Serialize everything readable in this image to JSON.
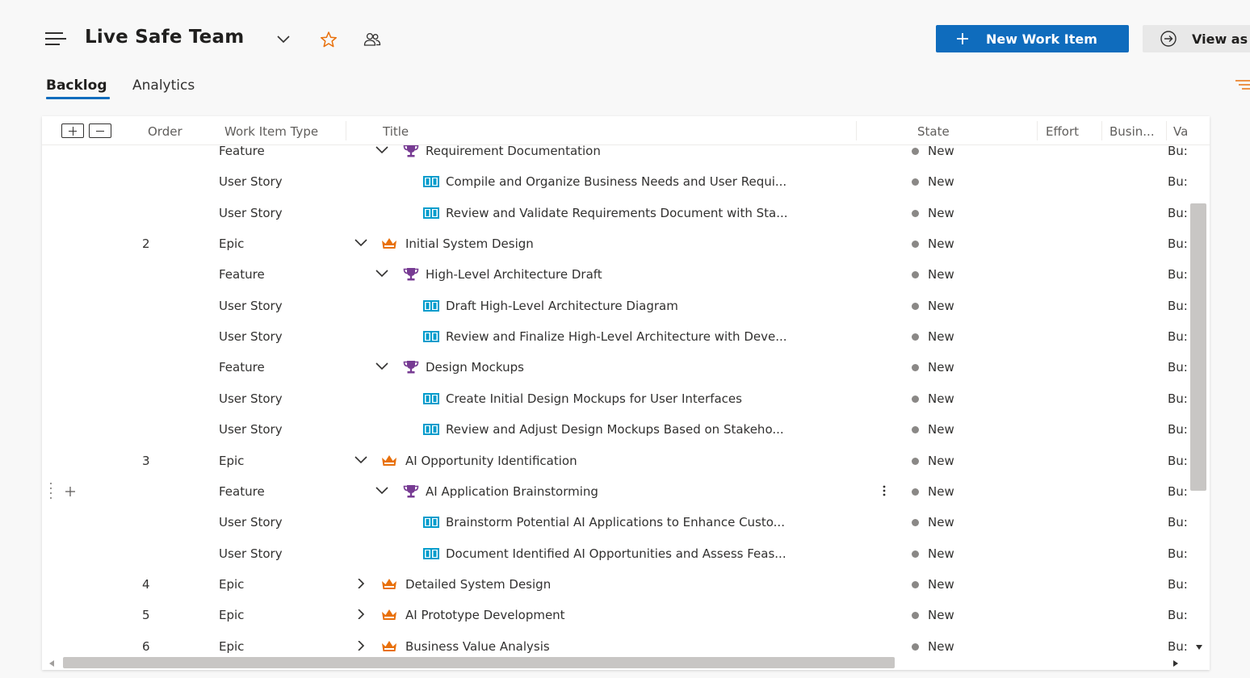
{
  "header": {
    "team_name": "Live Safe Team",
    "new_work_item_label": "New Work Item",
    "view_as_label": "View as"
  },
  "tabs": [
    {
      "label": "Backlog",
      "active": true
    },
    {
      "label": "Analytics",
      "active": false
    }
  ],
  "colors": {
    "accent": "#0f6cbd",
    "epic_icon": "#e8700c",
    "feature_icon": "#773b93",
    "story_icon": "#009ccc",
    "state_new": "#8a8886"
  },
  "grid": {
    "columns": {
      "order": "Order",
      "type": "Work Item Type",
      "title": "Title",
      "state": "State",
      "effort": "Effort",
      "business": "Busin...",
      "value": "Va"
    },
    "rows": [
      {
        "order": "",
        "type": "Feature",
        "title": "Requirement Documentation",
        "state": "New",
        "bv": "Bu:",
        "icon": "trophy-icon"
      },
      {
        "order": "",
        "type": "User Story",
        "title": "Compile and Organize Business Needs and User Requi...",
        "state": "New",
        "bv": "Bu:",
        "icon": "book-icon"
      },
      {
        "order": "",
        "type": "User Story",
        "title": "Review and Validate Requirements Document with Sta...",
        "state": "New",
        "bv": "Bu:",
        "icon": "book-icon"
      },
      {
        "order": "2",
        "type": "Epic",
        "title": "Initial System Design",
        "state": "New",
        "bv": "Bu:",
        "icon": "crown-icon"
      },
      {
        "order": "",
        "type": "Feature",
        "title": "High-Level Architecture Draft",
        "state": "New",
        "bv": "Bu:",
        "icon": "trophy-icon"
      },
      {
        "order": "",
        "type": "User Story",
        "title": "Draft High-Level Architecture Diagram",
        "state": "New",
        "bv": "Bu:",
        "icon": "book-icon"
      },
      {
        "order": "",
        "type": "User Story",
        "title": "Review and Finalize High-Level Architecture with Deve...",
        "state": "New",
        "bv": "Bu:",
        "icon": "book-icon"
      },
      {
        "order": "",
        "type": "Feature",
        "title": "Design Mockups",
        "state": "New",
        "bv": "Bu:",
        "icon": "trophy-icon"
      },
      {
        "order": "",
        "type": "User Story",
        "title": "Create Initial Design Mockups for User Interfaces",
        "state": "New",
        "bv": "Bu:",
        "icon": "book-icon"
      },
      {
        "order": "",
        "type": "User Story",
        "title": "Review and Adjust Design Mockups Based on Stakeho...",
        "state": "New",
        "bv": "Bu:",
        "icon": "book-icon"
      },
      {
        "order": "3",
        "type": "Epic",
        "title": "AI Opportunity Identification",
        "state": "New",
        "bv": "Bu:",
        "icon": "crown-icon"
      },
      {
        "order": "",
        "type": "Feature",
        "title": "AI Application Brainstorming",
        "state": "New",
        "bv": "Bu:",
        "icon": "trophy-icon"
      },
      {
        "order": "",
        "type": "User Story",
        "title": "Brainstorm Potential AI Applications to Enhance Custo...",
        "state": "New",
        "bv": "Bu:",
        "icon": "book-icon"
      },
      {
        "order": "",
        "type": "User Story",
        "title": "Document Identified AI Opportunities and Assess Feas...",
        "state": "New",
        "bv": "Bu:",
        "icon": "book-icon"
      },
      {
        "order": "4",
        "type": "Epic",
        "title": "Detailed System Design",
        "state": "New",
        "bv": "Bu:",
        "icon": "crown-icon"
      },
      {
        "order": "5",
        "type": "Epic",
        "title": "AI Prototype Development",
        "state": "New",
        "bv": "Bu:",
        "icon": "crown-icon"
      },
      {
        "order": "6",
        "type": "Epic",
        "title": "Business Value Analysis",
        "state": "New",
        "bv": "Bu:",
        "icon": "crown-icon"
      }
    ]
  }
}
